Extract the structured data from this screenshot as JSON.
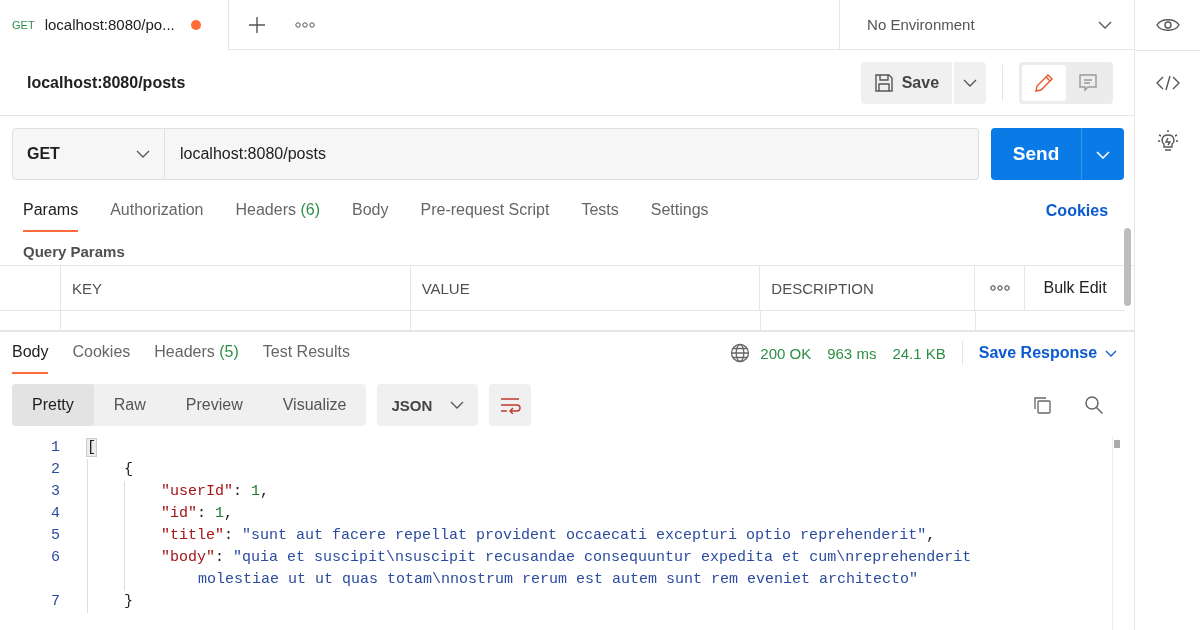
{
  "tabs": [
    {
      "method": "GET",
      "title": "localhost:8080/po...",
      "unsaved": true,
      "selected": true
    }
  ],
  "environment": "No Environment",
  "request": {
    "name": "localhost:8080/posts",
    "save": "Save",
    "method": "GET",
    "url": "localhost:8080/posts",
    "send": "Send"
  },
  "mode_toggle": [
    {
      "kind": "edit",
      "selected": true
    },
    {
      "kind": "comment",
      "selected": false
    }
  ],
  "request_tabs": [
    {
      "label": "Params",
      "selected": true
    },
    {
      "label": "Authorization",
      "selected": false
    },
    {
      "label": "Headers",
      "count": "(6)",
      "selected": false
    },
    {
      "label": "Body",
      "selected": false
    },
    {
      "label": "Pre-request Script",
      "selected": false
    },
    {
      "label": "Tests",
      "selected": false
    },
    {
      "label": "Settings",
      "selected": false
    }
  ],
  "cookies_link": "Cookies",
  "query_params": {
    "title": "Query Params",
    "columns": [
      "KEY",
      "VALUE",
      "DESCRIPTION"
    ],
    "bulk_edit": "Bulk Edit"
  },
  "response": {
    "tabs": [
      {
        "label": "Body",
        "selected": true
      },
      {
        "label": "Cookies",
        "selected": false
      },
      {
        "label": "Headers",
        "count": "(5)",
        "selected": false
      },
      {
        "label": "Test Results",
        "selected": false
      }
    ],
    "status": "200 OK",
    "time": "963 ms",
    "size": "24.1 KB",
    "save_response": "Save Response",
    "views": [
      {
        "label": "Pretty",
        "selected": true
      },
      {
        "label": "Raw",
        "selected": false
      },
      {
        "label": "Preview",
        "selected": false
      },
      {
        "label": "Visualize",
        "selected": false
      }
    ],
    "format": "JSON",
    "code": [
      {
        "number": "1",
        "tokens": [
          {
            "kind": "punct",
            "text": "["
          }
        ],
        "children": [
          {
            "number": "2",
            "tokens": [
              {
                "kind": "punct",
                "text": "{"
              }
            ],
            "children": [
              {
                "number": "3",
                "tokens": [
                  {
                    "kind": "key",
                    "text": "\"userId\""
                  },
                  {
                    "kind": "punct",
                    "text": ": "
                  },
                  {
                    "kind": "number",
                    "text": "1"
                  },
                  {
                    "kind": "punct",
                    "text": ","
                  }
                ]
              },
              {
                "number": "4",
                "tokens": [
                  {
                    "kind": "key",
                    "text": "\"id\""
                  },
                  {
                    "kind": "punct",
                    "text": ": "
                  },
                  {
                    "kind": "number",
                    "text": "1"
                  },
                  {
                    "kind": "punct",
                    "text": ","
                  }
                ]
              },
              {
                "number": "5",
                "tokens": [
                  {
                    "kind": "key",
                    "text": "\"title\""
                  },
                  {
                    "kind": "punct",
                    "text": ": "
                  },
                  {
                    "kind": "string",
                    "text": "\"sunt aut facere repellat provident occaecati excepturi optio reprehenderit\""
                  },
                  {
                    "kind": "punct",
                    "text": ","
                  }
                ]
              },
              {
                "number": "6",
                "tokens": [
                  {
                    "kind": "key",
                    "text": "\"body\""
                  },
                  {
                    "kind": "punct",
                    "text": ": "
                  },
                  {
                    "kind": "string",
                    "text": "\"quia et suscipit\\nsuscipit recusandae consequuntur expedita et cum\\nreprehenderit"
                  }
                ],
                "wrap": [
                  {
                    "kind": "string",
                    "text": "molestiae ut ut quas totam\\nnostrum rerum est autem sunt rem eveniet architecto\""
                  }
                ]
              }
            ]
          },
          {
            "number": "7",
            "tokens": [
              {
                "kind": "punct",
                "text": "}"
              }
            ]
          }
        ]
      }
    ]
  }
}
